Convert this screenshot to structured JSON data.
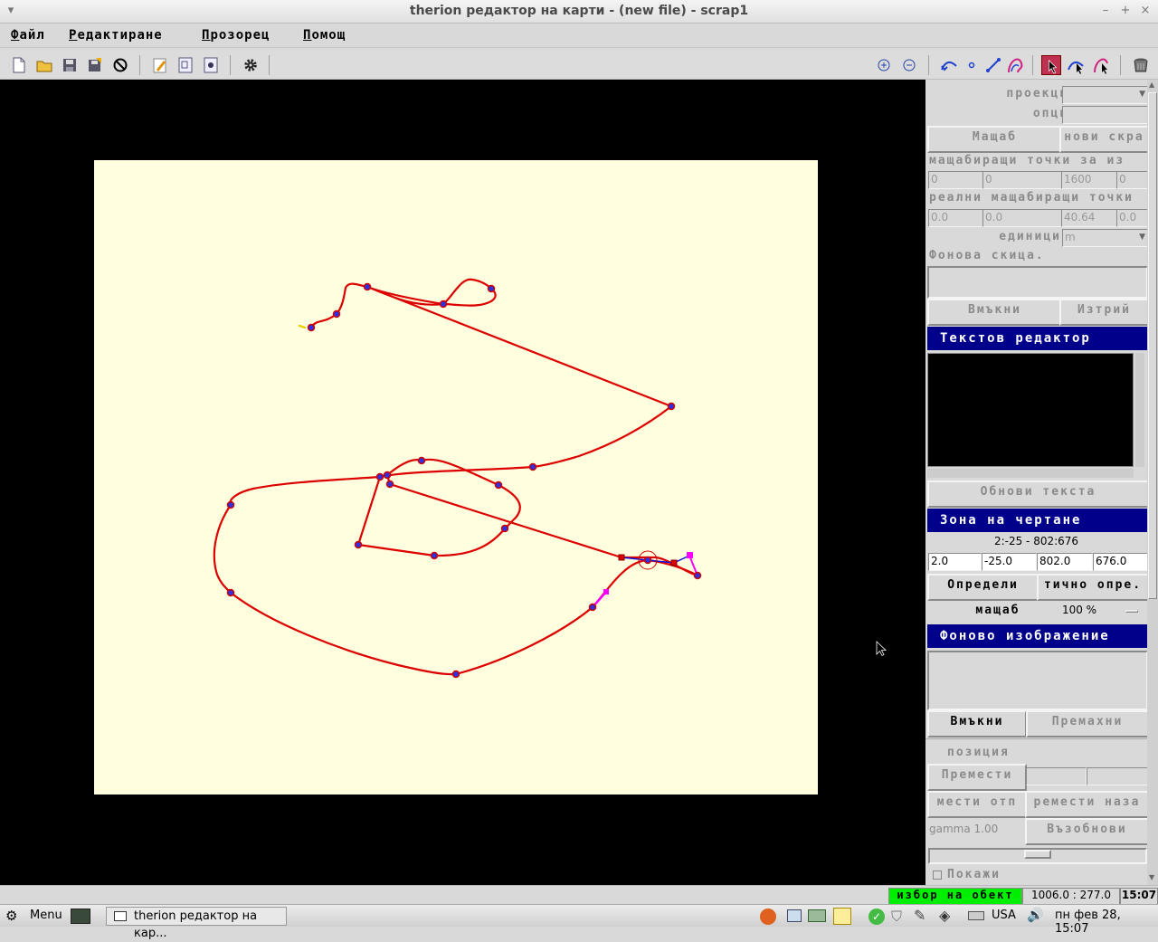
{
  "window": {
    "title": "therion редактор на карти - (new file) - scrap1"
  },
  "menu": {
    "file": {
      "first": "Ф",
      "rest": "айл"
    },
    "edit": {
      "first": "Р",
      "rest": "едактиране"
    },
    "window": {
      "first": "П",
      "rest": "розорец"
    },
    "help": {
      "first": "П",
      "rest": "омощ"
    }
  },
  "panel": {
    "projection_label": "проекция",
    "options_label": "опции",
    "scale_button": "Мащаб",
    "new_scrap_button": "нови скра",
    "scale_points_label": "мащабиращи точки за из",
    "scale_points": [
      "0",
      "0",
      "1600",
      "0"
    ],
    "real_points_label": "реални мащабиращи точки",
    "real_points": [
      "0.0",
      "0.0",
      "40.64",
      "0.0"
    ],
    "units_label": "единици",
    "units_value": "m",
    "sketch_label": "Фонова скица.",
    "insert_button": "Вмъкни",
    "delete_button": "Изтрий",
    "text_editor_header": "Текстов редактор",
    "update_text_button": "Обнови текста",
    "drawing_area_header": "Зона на чертане",
    "drawing_area_range": "2:-25 - 802:676",
    "drawing_area_fields": [
      "2.0",
      "-25.0",
      "802.0",
      "676.0"
    ],
    "define_button": "Определи",
    "auto_define_button": "тично опре.",
    "zoom_label": "мащаб",
    "zoom_value": "100 %",
    "background_image_header": "Фоново изображение",
    "bg_insert_button": "Вмъкни",
    "bg_remove_button": "Премахни",
    "position_label": "позиция",
    "move_button": "Премести",
    "move_back_button": "мести отп",
    "move_fwd_button": "ремести наза",
    "gamma_label": "gamma 1.00",
    "restore_button": "Възобнови",
    "show_label": "Покажи"
  },
  "status": {
    "mode": "избор на обект",
    "coords": "1006.0 : 277.0",
    "time": "15:07"
  },
  "taskbar": {
    "menu_label": "Menu",
    "task_label": "therion редактор на кар...",
    "layout": "USA",
    "datetime": "пн фев 28, 15:07"
  },
  "colors": {
    "paper": "#ffffe0",
    "line": "#dd0000",
    "point_fill": "#3030e0",
    "selected": "#ff00ff",
    "header": "#00008b",
    "status_mode": "#00ee00"
  },
  "icons": {
    "toolbar": [
      "new-file-icon",
      "open-icon",
      "save-icon",
      "save-as-icon",
      "close-icon",
      "edit-icon",
      "compile-icon",
      "settings-icon",
      "gear-icon",
      "zoom-in-icon",
      "zoom-out-icon",
      "insert-line-icon",
      "insert-point-icon",
      "insert-line-segment-icon",
      "insert-area-icon",
      "select-icon",
      "select-line-icon",
      "select-area-icon",
      "trash-icon"
    ]
  }
}
